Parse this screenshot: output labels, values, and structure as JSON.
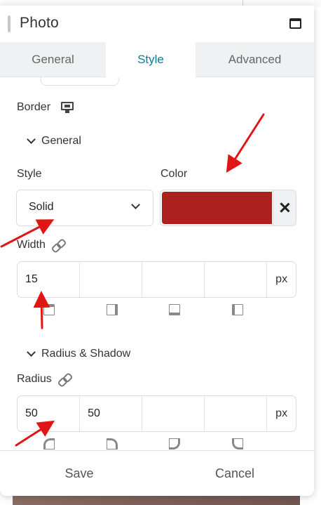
{
  "panel": {
    "title": "Photo"
  },
  "tabs": [
    {
      "label": "General",
      "active": false
    },
    {
      "label": "Style",
      "active": true
    },
    {
      "label": "Advanced",
      "active": false
    }
  ],
  "border": {
    "section_label": "Border",
    "general_toggle": "General",
    "style_label": "Style",
    "style_value": "Solid",
    "color_label": "Color",
    "color_value": "#ad2020",
    "width_label": "Width",
    "width_values": [
      "15",
      "",
      "",
      ""
    ],
    "width_unit": "px"
  },
  "radius_shadow": {
    "toggle_label": "Radius & Shadow",
    "radius_label": "Radius",
    "radius_values": [
      "50",
      "50",
      "",
      ""
    ],
    "radius_unit": "px"
  },
  "footer": {
    "save_label": "Save",
    "cancel_label": "Cancel"
  },
  "colors": {
    "accent": "#0e7a94",
    "annotation_arrow": "#e11515"
  }
}
